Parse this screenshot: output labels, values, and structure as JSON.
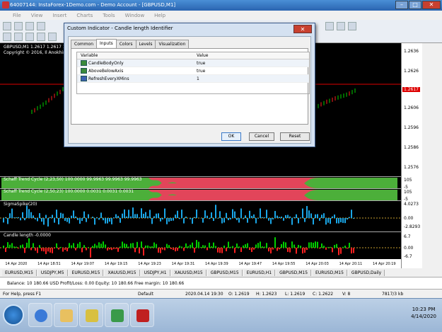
{
  "window": {
    "title": "64007144: InstaForex-1Demo.com - Demo Account - [GBPUSD,M1]"
  },
  "menu": [
    "File",
    "View",
    "Insert",
    "Charts",
    "Tools",
    "Window",
    "Help"
  ],
  "chart": {
    "header_line1": "GBPUSD,M1  1.2617 1.2617 1.2",
    "header_line2": "Copyright © 2016, Il Anokhin",
    "prices": [
      "1.2636",
      "1.2626",
      "1.2616",
      "1.2606",
      "1.2596",
      "1.2586",
      "1.2576"
    ],
    "current_price_badge": "1.2617",
    "time_labels": [
      "14 Apr 2020",
      "14 Apr 18:51",
      "14 Apr 19:07",
      "14 Apr 19:15",
      "14 Apr 19:23",
      "14 Apr 19:31",
      "14 Apr 19:39",
      "14 Apr 19:47",
      "14 Apr 19:55",
      "14 Apr 20:03",
      "14 Apr 20:11",
      "14 Apr 20:19"
    ]
  },
  "indicators": {
    "schaff1": {
      "label": "Schaff Trend Cycle (2,23,50) 100.0000 99.9963 99.9963 99.9963",
      "scale_top": "105",
      "scale_bot": "-5"
    },
    "schaff2": {
      "label": "Schaff Trend Cycle (2,50,23) 100.0000 0.0031 0.0031 0.0031",
      "scale_top": "105",
      "scale_bot": "-5"
    },
    "sigma": {
      "label": "SigmaSpike(20)",
      "scale_top": "4.0273",
      "scale_mid": "0.00",
      "scale_bot": "-2.8293"
    },
    "candle": {
      "label": "Candle length -0.0000",
      "scale_top": "6.7",
      "scale_mid": "0.00",
      "scale_bot": "-6.7"
    }
  },
  "symbol_tabs": [
    "EURUSD,M15",
    "USDJPY,M5",
    "EURUSD,M15",
    "XAUUSD,M15",
    "USDJPY,H1",
    "XAUUSD,M15",
    "GBPUSD,M15",
    "EURUSD,H1",
    "GBPUSD,M15",
    "EURUSD,M15",
    "GBPUSD,Daily"
  ],
  "balance": {
    "text": "Balance: 10 180.66 USD  Profit/Loss: 0.00  Equity: 10 180.66  Free margin: 10 180.66"
  },
  "status": {
    "help": "For Help, press F1",
    "profile": "Default",
    "datetime": "2020.04.14 19:30",
    "open": "O: 1.2619",
    "high": "H: 1.2623",
    "low": "L: 1.2619",
    "close": "C: 1.2622",
    "volume": "V: 8",
    "traffic": "7817/3 kb"
  },
  "taskbar": {
    "time": "10:23 PM",
    "date": "4/14/2020"
  },
  "dialog": {
    "title": "Custom Indicator - Candle length Identifier",
    "close": "✕",
    "tabs": [
      "Common",
      "Inputs",
      "Colors",
      "Levels",
      "Visualization"
    ],
    "columns": [
      "Variable",
      "Value"
    ],
    "rows": [
      {
        "variable": "CandleBodyOnly",
        "value": "true",
        "icon": "bool-icon"
      },
      {
        "variable": "AboveBelowAxis",
        "value": "true",
        "icon": "bool-icon"
      },
      {
        "variable": "RefreshEveryXMins",
        "value": "1",
        "icon": "number-icon"
      }
    ],
    "buttons": {
      "ok": "OK",
      "cancel": "Cancel",
      "reset": "Reset"
    }
  },
  "colors": {
    "up": "#00d000",
    "down": "#ff2020",
    "schaff_green": "#4caf3a",
    "schaff_red": "#e2455a",
    "sigma": "#1aa7e8",
    "accent": "#2a64b0"
  }
}
